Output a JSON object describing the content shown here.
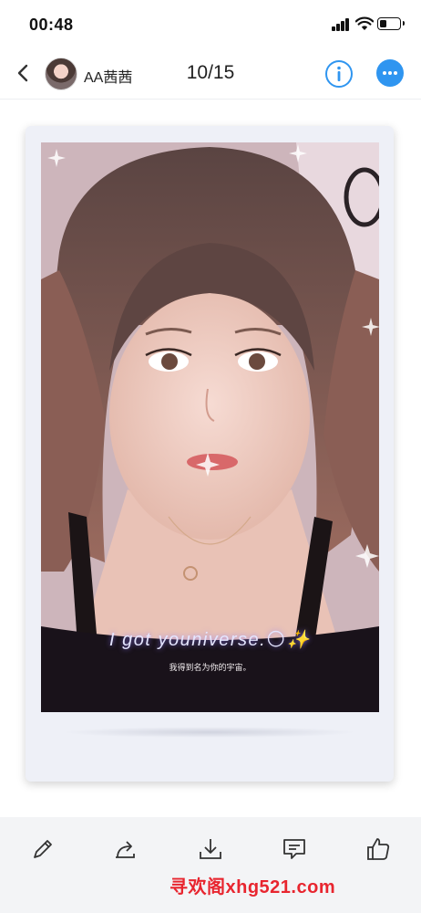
{
  "status_bar": {
    "time": "00:48",
    "battery_level": 0.35
  },
  "nav": {
    "user_name": "AA茜茜",
    "page_counter": "10/15",
    "icons": [
      "chevron-left-icon",
      "info-icon",
      "more-icon"
    ],
    "accent_color": "#2f95f0"
  },
  "photo": {
    "caption": "I got youniverse.",
    "caption_emoji": "🌕✨",
    "subcaption": "我得到名为你的宇宙。"
  },
  "toolbar": {
    "icons": [
      "pencil-icon",
      "share-icon",
      "download-icon",
      "comment-icon",
      "thumbs-up-icon"
    ]
  },
  "watermark": "寻欢阁xhg521.com"
}
